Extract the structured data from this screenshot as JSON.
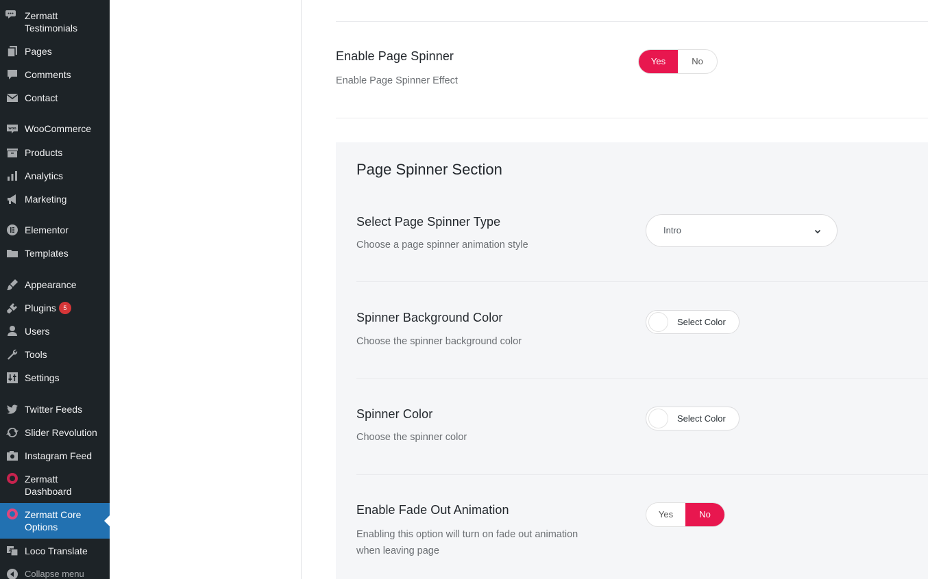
{
  "sidebar": {
    "items": [
      {
        "label": "Zermatt Testimonials",
        "icon": "speech-bubbles-icon"
      },
      {
        "label": "Pages",
        "icon": "pages-icon"
      },
      {
        "label": "Comments",
        "icon": "comment-icon"
      },
      {
        "label": "Contact",
        "icon": "envelope-icon"
      },
      {
        "label": "WooCommerce",
        "icon": "woo-icon"
      },
      {
        "label": "Products",
        "icon": "archive-box-icon"
      },
      {
        "label": "Analytics",
        "icon": "bar-chart-icon"
      },
      {
        "label": "Marketing",
        "icon": "megaphone-icon"
      },
      {
        "label": "Elementor",
        "icon": "elementor-icon"
      },
      {
        "label": "Templates",
        "icon": "folder-icon"
      },
      {
        "label": "Appearance",
        "icon": "paintbrush-icon"
      },
      {
        "label": "Plugins",
        "icon": "plugin-icon",
        "badge": "5"
      },
      {
        "label": "Users",
        "icon": "user-icon"
      },
      {
        "label": "Tools",
        "icon": "wrench-icon"
      },
      {
        "label": "Settings",
        "icon": "sliders-icon"
      },
      {
        "label": "Twitter Feeds",
        "icon": "twitter-bird-icon"
      },
      {
        "label": "Slider Revolution",
        "icon": "refresh-icon"
      },
      {
        "label": "Instagram Feed",
        "icon": "camera-icon"
      },
      {
        "label": "Zermatt Dashboard",
        "icon": "zermatt-logo-icon"
      },
      {
        "label": "Zermatt Core Options",
        "icon": "zermatt-logo-icon",
        "current": true
      },
      {
        "label": "Loco Translate",
        "icon": "translate-icon"
      }
    ],
    "collapse_label": "Collapse menu"
  },
  "page_spinner": {
    "title": "Enable Page Spinner",
    "description": "Enable Page Spinner Effect",
    "yes": "Yes",
    "no": "No",
    "selected": "Yes"
  },
  "section": {
    "title": "Page Spinner Section",
    "spinner_type": {
      "title": "Select Page Spinner Type",
      "description": "Choose a page spinner animation style",
      "value": "Intro"
    },
    "bg_color": {
      "title": "Spinner Background Color",
      "description": "Choose the spinner background color",
      "button": "Select Color"
    },
    "spinner_color": {
      "title": "Spinner Color",
      "description": "Choose the spinner color",
      "button": "Select Color"
    },
    "fade_out": {
      "title": "Enable Fade Out Animation",
      "description": "Enabling this option will turn on fade out animation when leaving page",
      "yes": "Yes",
      "no": "No",
      "selected": "No"
    }
  },
  "colors": {
    "sidebar_bg": "#1d2327",
    "current_item_bg": "#2271b1",
    "toggle_active": "#e8174f",
    "badge": "#d63638",
    "section_bg": "#f5f6f8"
  }
}
